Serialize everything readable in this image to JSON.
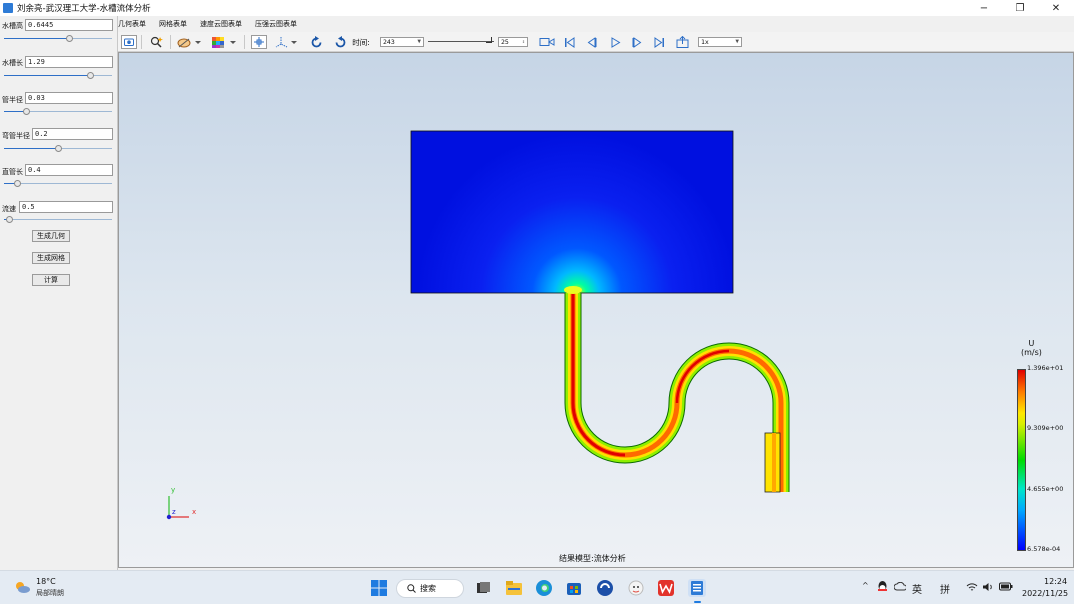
{
  "window": {
    "title": "刘余亮-武汉理工大学-水槽流体分析",
    "minimize": "−",
    "restore": "❐",
    "close": "✕"
  },
  "menu": [
    "几何表单",
    "网格表单",
    "速度云图表单",
    "压强云图表单"
  ],
  "params": [
    {
      "label": "水槽高",
      "value": "0.6445",
      "fraction": 0.6
    },
    {
      "label": "水槽长",
      "value": "1.29",
      "fraction": 0.8
    },
    {
      "label": "管半径",
      "value": "0.03",
      "fraction": 0.2
    },
    {
      "label": "弯管半径",
      "value": "0.2",
      "fraction": 0.5
    },
    {
      "label": "直管长",
      "value": "0.4",
      "fraction": 0.12
    },
    {
      "label": "流速",
      "value": "0.5",
      "fraction": 0.05
    }
  ],
  "buttons": {
    "gen_geometry": "生成几何",
    "gen_mesh": "生成网格",
    "compute": "计算"
  },
  "toolbar": {
    "time_label": "时间:",
    "time_value": "243",
    "step_value": "25",
    "speed_value": "1x"
  },
  "viewport": {
    "result_label": "结果模型:流体分析",
    "axis_x": "x",
    "axis_y": "y",
    "axis_z": "z"
  },
  "legend": {
    "variable": "U",
    "unit": "(m/s)",
    "ticks": [
      "1.396e+01",
      "9.309e+00",
      "4.655e+00",
      "6.578e-04"
    ],
    "max_color": "#e00000",
    "min_color": "#0000ff"
  },
  "taskbar": {
    "temperature": "18°C",
    "weather": "局部晴朗",
    "search": "搜索",
    "ime_lang": "英",
    "ime_mode": "拼",
    "time": "12:24",
    "date": "2022/11/25"
  }
}
